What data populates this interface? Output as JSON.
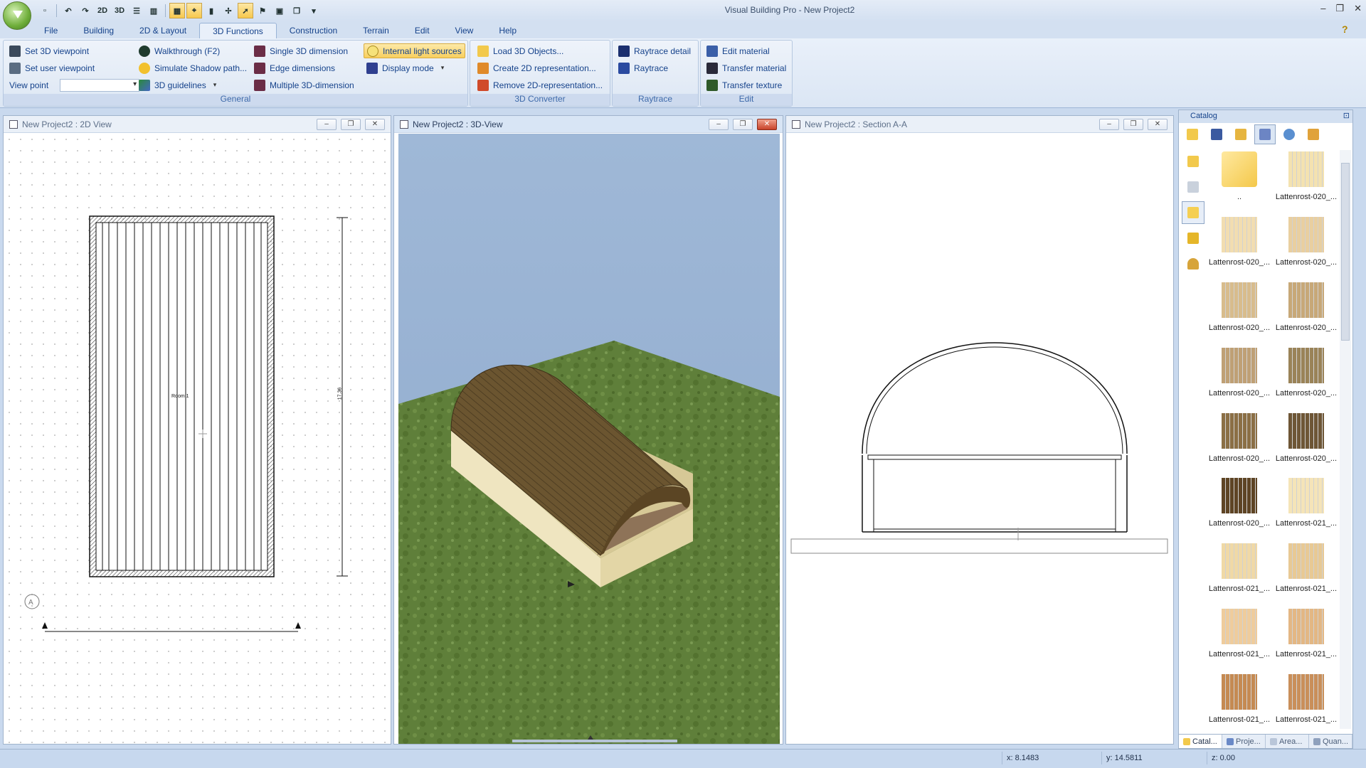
{
  "app": {
    "title": "Visual Building Pro - New Project2"
  },
  "quick_access": {
    "btn_2d": "2D",
    "btn_3d": "3D"
  },
  "menu_tabs": [
    "File",
    "Building",
    "2D & Layout",
    "3D Functions",
    "Construction",
    "Terrain",
    "Edit",
    "View",
    "Help"
  ],
  "active_tab": "3D Functions",
  "ribbon": {
    "general": {
      "label": "General",
      "set_3d_viewpoint": "Set 3D viewpoint",
      "set_user_viewpoint": "Set user viewpoint",
      "view_point_label": "View point",
      "walkthrough": "Walkthrough (F2)",
      "simulate_shadow": "Simulate Shadow path...",
      "guidelines_3d": "3D guidelines",
      "single_3d_dimension": "Single 3D dimension",
      "edge_dimensions": "Edge dimensions",
      "multiple_3d_dimension": "Multiple 3D-dimension",
      "internal_light_sources": "Internal light sources",
      "display_mode": "Display mode"
    },
    "converter": {
      "label": "3D Converter",
      "load_3d_objects": "Load 3D Objects...",
      "create_2d": "Create 2D representation...",
      "remove_2d": "Remove 2D-representation..."
    },
    "raytrace": {
      "label": "Raytrace",
      "raytrace_detail": "Raytrace detail",
      "raytrace": "Raytrace"
    },
    "edit": {
      "label": "Edit",
      "edit_material": "Edit material",
      "transfer_material": "Transfer material",
      "transfer_texture": "Transfer texture"
    }
  },
  "panels": {
    "view2d": {
      "title": "New Project2 : 2D View",
      "room_label": "Room 1",
      "dimension": "17.36"
    },
    "view3d": {
      "title": "New Project2 : 3D-View"
    },
    "section": {
      "title": "New Project2 : Section A-A"
    }
  },
  "catalog": {
    "title": "Catalog",
    "items": [
      {
        "label": "..",
        "color": "#f4c84a"
      },
      {
        "label": "Lattenrost-020_...",
        "color": "#f4e2b0"
      },
      {
        "label": "Lattenrost-020_...",
        "color": "#f2ddb0"
      },
      {
        "label": "Lattenrost-020_...",
        "color": "#e9cfa0"
      },
      {
        "label": "Lattenrost-020_...",
        "color": "#d8bc8c"
      },
      {
        "label": "Lattenrost-020_...",
        "color": "#c7a878"
      },
      {
        "label": "Lattenrost-020_...",
        "color": "#bfa075"
      },
      {
        "label": "Lattenrost-020_...",
        "color": "#9a8358"
      },
      {
        "label": "Lattenrost-020_...",
        "color": "#8b6f45"
      },
      {
        "label": "Lattenrost-020_...",
        "color": "#6e5636"
      },
      {
        "label": "Lattenrost-020_...",
        "color": "#5e4424"
      },
      {
        "label": "Lattenrost-021_...",
        "color": "#f5e4b8"
      },
      {
        "label": "Lattenrost-021_...",
        "color": "#f0d9a6"
      },
      {
        "label": "Lattenrost-021_...",
        "color": "#e8c994"
      },
      {
        "label": "Lattenrost-021_...",
        "color": "#efcc9c"
      },
      {
        "label": "Lattenrost-021_...",
        "color": "#e3b784"
      },
      {
        "label": "Lattenrost-021_...",
        "color": "#c58a52"
      },
      {
        "label": "Lattenrost-021_...",
        "color": "#c98f5a"
      }
    ],
    "tabs": [
      "Catal...",
      "Proje...",
      "Area...",
      "Quan..."
    ]
  },
  "status": {
    "x": "x: 8.1483",
    "y": "y: 14.5811",
    "z": "z: 0.00"
  }
}
